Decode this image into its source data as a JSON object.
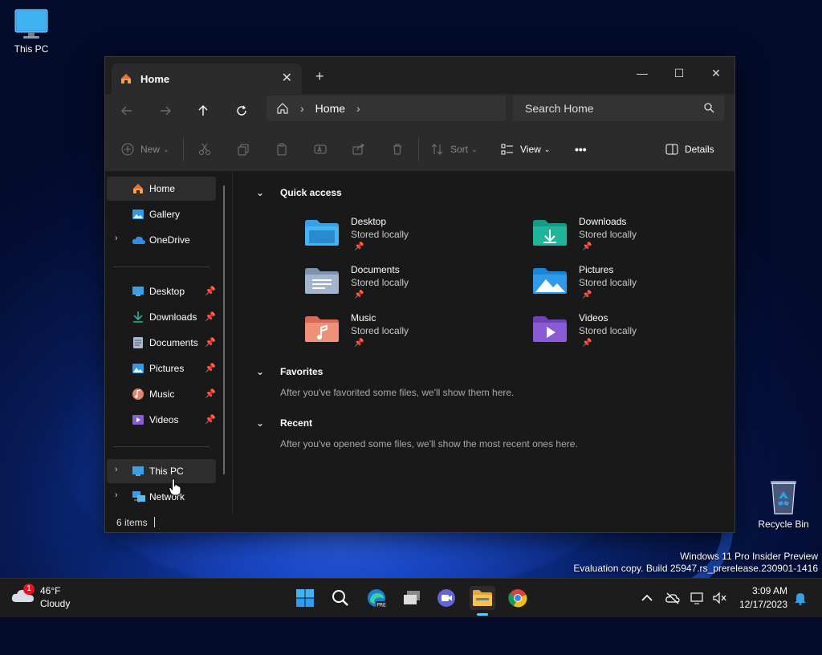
{
  "desktop": {
    "icons": [
      {
        "label": "This PC",
        "icon": "monitor-icon"
      },
      {
        "label": "Recycle Bin",
        "icon": "recycle-bin-icon"
      }
    ],
    "watermark_line1": "Windows 11 Pro Insider Preview",
    "watermark_line2": "Evaluation copy. Build 25947.rs_prerelease.230901-1416"
  },
  "window": {
    "tab_title": "Home",
    "tab_close": "✕",
    "new_tab": "+",
    "controls": {
      "minimize": "—",
      "maximize": "☐",
      "close": "✕"
    },
    "address": {
      "crumb": "Home"
    },
    "search": {
      "placeholder": "Search Home"
    },
    "toolbar": {
      "new_label": "New",
      "sort_label": "Sort",
      "view_label": "View",
      "more": "•••",
      "details_label": "Details"
    },
    "sidebar": {
      "items": [
        {
          "label": "Home",
          "icon": "home-icon"
        },
        {
          "label": "Gallery",
          "icon": "gallery-icon"
        },
        {
          "label": "OneDrive",
          "icon": "cloud-icon"
        },
        {
          "label": "Desktop",
          "icon": "desktop-icon"
        },
        {
          "label": "Downloads",
          "icon": "download-icon"
        },
        {
          "label": "Documents",
          "icon": "documents-icon"
        },
        {
          "label": "Pictures",
          "icon": "pictures-icon"
        },
        {
          "label": "Music",
          "icon": "music-icon"
        },
        {
          "label": "Videos",
          "icon": "videos-icon"
        },
        {
          "label": "This PC",
          "icon": "monitor-icon"
        },
        {
          "label": "Network",
          "icon": "network-icon"
        }
      ]
    },
    "content": {
      "quick_access_title": "Quick access",
      "quick_access": [
        {
          "name": "Desktop",
          "sub": "Stored locally",
          "color": "#3aa0e6"
        },
        {
          "name": "Downloads",
          "sub": "Stored locally",
          "color": "#1fb59b"
        },
        {
          "name": "Documents",
          "sub": "Stored locally",
          "color": "#8fa6c4"
        },
        {
          "name": "Pictures",
          "sub": "Stored locally",
          "color": "#2f9be8"
        },
        {
          "name": "Music",
          "sub": "Stored locally",
          "color": "#e8836b"
        },
        {
          "name": "Videos",
          "sub": "Stored locally",
          "color": "#8b5bd6"
        }
      ],
      "favorites_title": "Favorites",
      "favorites_empty": "After you've favorited some files, we'll show them here.",
      "recent_title": "Recent",
      "recent_empty": "After you've opened some files, we'll show the most recent ones here."
    },
    "status": {
      "count": "6 items"
    }
  },
  "taskbar": {
    "weather_temp": "46°F",
    "weather_cond": "Cloudy",
    "weather_badge": "1",
    "time": "3:09 AM",
    "date": "12/17/2023"
  }
}
